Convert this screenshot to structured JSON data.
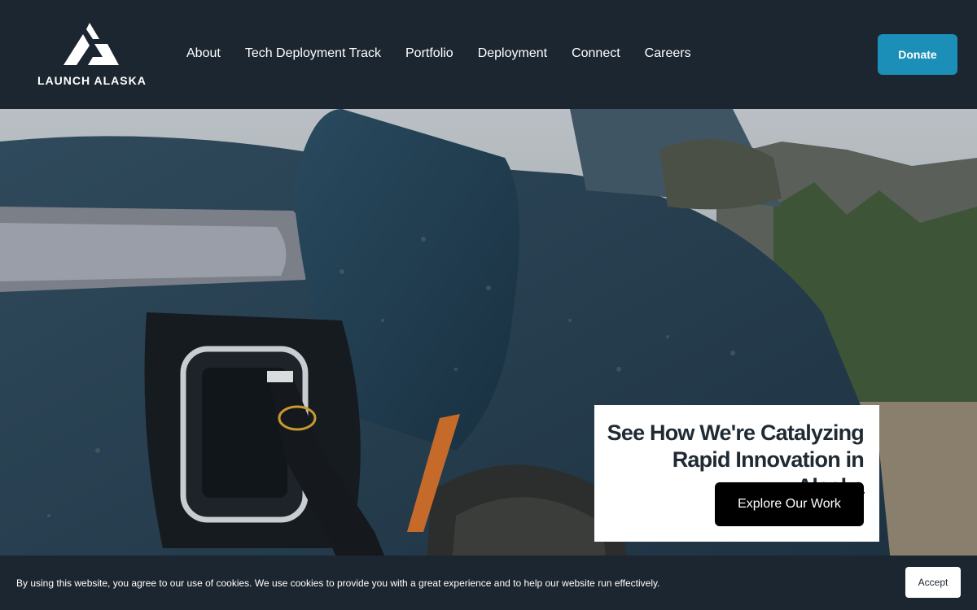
{
  "logo": {
    "text": "LAUNCH ALASKA"
  },
  "nav": {
    "items": [
      {
        "label": "About"
      },
      {
        "label": "Tech Deployment Track"
      },
      {
        "label": "Portfolio"
      },
      {
        "label": "Deployment"
      },
      {
        "label": "Connect"
      },
      {
        "label": "Careers"
      }
    ]
  },
  "header": {
    "donate_label": "Donate"
  },
  "hero": {
    "title": "See How We're Catalyzing Rapid Innovation in Alaska",
    "button_label": "Explore Our Work"
  },
  "cookie": {
    "text": "By using this website, you agree to our use of cookies. We use cookies to provide you with a great experience and to help our website run effectively.",
    "accept_label": "Accept"
  },
  "colors": {
    "header_bg": "#1c2630",
    "accent": "#1b8fb8"
  }
}
